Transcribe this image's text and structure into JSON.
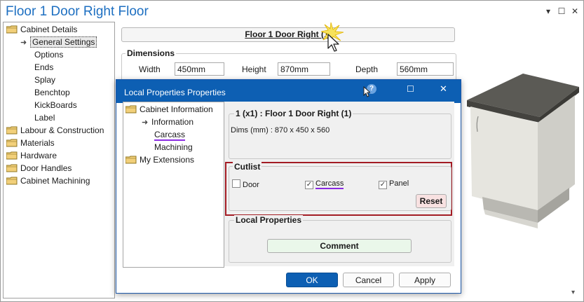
{
  "outer_window": {
    "title": "Floor 1 Door Right Floor",
    "chevron_glyph": "▾",
    "maximize_glyph": "☐",
    "close_glyph": "✕"
  },
  "tree": {
    "items": [
      {
        "label": "Cabinet Details"
      },
      {
        "label": "General Settings"
      },
      {
        "label": "Options"
      },
      {
        "label": "Ends"
      },
      {
        "label": "Splay"
      },
      {
        "label": "Benchtop"
      },
      {
        "label": "KickBoards"
      },
      {
        "label": "Label"
      },
      {
        "label": "Labour & Construction"
      },
      {
        "label": "Materials"
      },
      {
        "label": "Hardware"
      },
      {
        "label": "Door Handles"
      },
      {
        "label": "Cabinet Machining"
      }
    ]
  },
  "header": {
    "cabinet_button_label": "Floor 1 Door Right (1)"
  },
  "dimensions": {
    "title": "Dimensions",
    "width_label": "Width",
    "width_value": "450mm",
    "height_label": "Height",
    "height_value": "870mm",
    "depth_label": "Depth",
    "depth_value": "560mm"
  },
  "dialog": {
    "title": "Local Properties Properties",
    "help_glyph": "?",
    "maximize_glyph": "☐",
    "close_glyph": "✕",
    "tree": {
      "items": [
        {
          "label": "Cabinet Information"
        },
        {
          "label": "Information"
        },
        {
          "label": "Carcass"
        },
        {
          "label": "Machining"
        },
        {
          "label": "My Extensions"
        }
      ]
    },
    "info_group_title": "1 (x1) : Floor 1 Door Right (1)",
    "dims_text": "Dims (mm) : 870 x 450 x 560",
    "cutlist": {
      "title": "Cutlist",
      "door_label": "Door",
      "door_checked": false,
      "carcass_label": "Carcass",
      "carcass_checked": true,
      "panel_label": "Panel",
      "panel_checked": true,
      "reset_label": "Reset"
    },
    "local_properties": {
      "title": "Local Properties",
      "comment_label": "Comment"
    },
    "ok_label": "OK",
    "cancel_label": "Cancel",
    "apply_label": "Apply"
  },
  "colors": {
    "title_blue": "#1d6fc1",
    "dialog_title_bar": "#0d5fb3",
    "highlight_box": "#a31c24",
    "purple_underline": "#8a2be2",
    "reset_bg": "#f8e1e1",
    "comment_bg": "#eaf7ea"
  },
  "icons": {
    "folder": "folder-icon",
    "arrow": "arrow-right-icon",
    "cursor": "mouse-cursor-icon",
    "click_burst": "click-burst-icon",
    "checkbox": "checkbox-icon"
  }
}
